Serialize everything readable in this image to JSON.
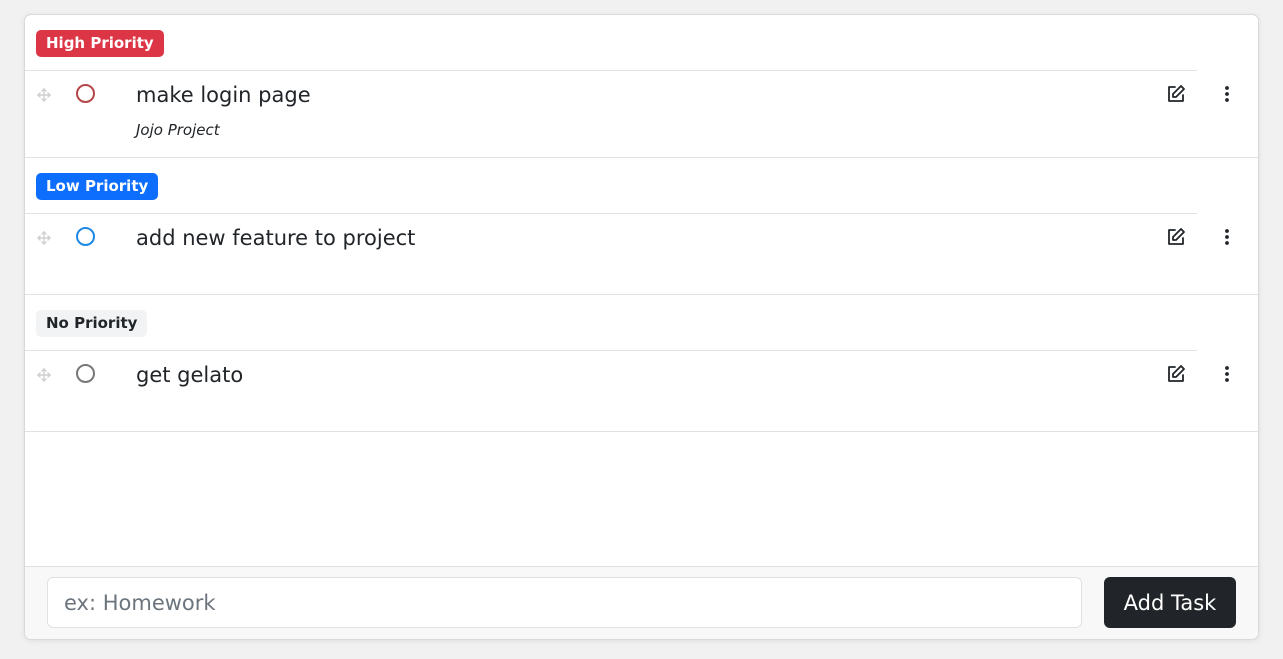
{
  "colors": {
    "high": "#dc3545",
    "low": "#0d6efd",
    "none_bg": "#f1f3f5",
    "check_high": "#b54646",
    "check_low": "#1e88e5",
    "check_none": "#777777",
    "button_bg": "#212529"
  },
  "groups": [
    {
      "badge": "High Priority",
      "task": {
        "title": "make login page",
        "project": "Jojo Project"
      }
    },
    {
      "badge": "Low Priority",
      "task": {
        "title": "add new feature to project",
        "project": ""
      }
    },
    {
      "badge": "No Priority",
      "task": {
        "title": "get gelato",
        "project": ""
      }
    }
  ],
  "icons": {
    "drag": "drag-handle-icon",
    "check": "circle-checkbox-icon",
    "edit": "edit-icon",
    "more": "vertical-dots-icon"
  },
  "footer": {
    "input_placeholder": "ex: Homework",
    "input_value": "",
    "add_button_label": "Add Task"
  }
}
